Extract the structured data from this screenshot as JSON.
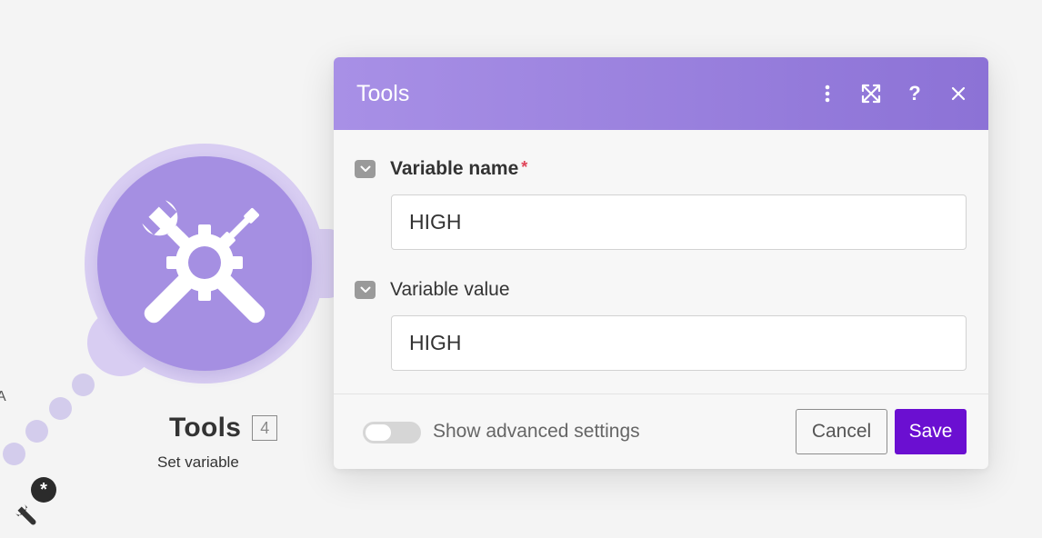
{
  "canvas": {
    "module": {
      "title": "Tools",
      "id_badge": "4",
      "subtitle": "Set variable",
      "icon": "tools-icon"
    },
    "edge_letter": "A",
    "star_badge": "*",
    "small_icon": "wrench-icon"
  },
  "dialog": {
    "title": "Tools",
    "header_icons": [
      "more-vertical-icon",
      "expand-icon",
      "help-icon",
      "close-icon"
    ],
    "help_glyph": "?",
    "fields": [
      {
        "label": "Variable name",
        "required": true,
        "required_mark": "*",
        "value": "HIGH"
      },
      {
        "label": "Variable value",
        "required": false,
        "value": "HIGH"
      }
    ],
    "footer": {
      "toggle_label": "Show advanced settings",
      "toggle_on": false,
      "cancel_label": "Cancel",
      "save_label": "Save"
    }
  },
  "colors": {
    "module_purple": "#a58fe2",
    "header_gradient_start": "#a890e6",
    "header_gradient_end": "#8c72d6",
    "save_button": "#6b0fd1",
    "required_star": "#e0455a"
  }
}
